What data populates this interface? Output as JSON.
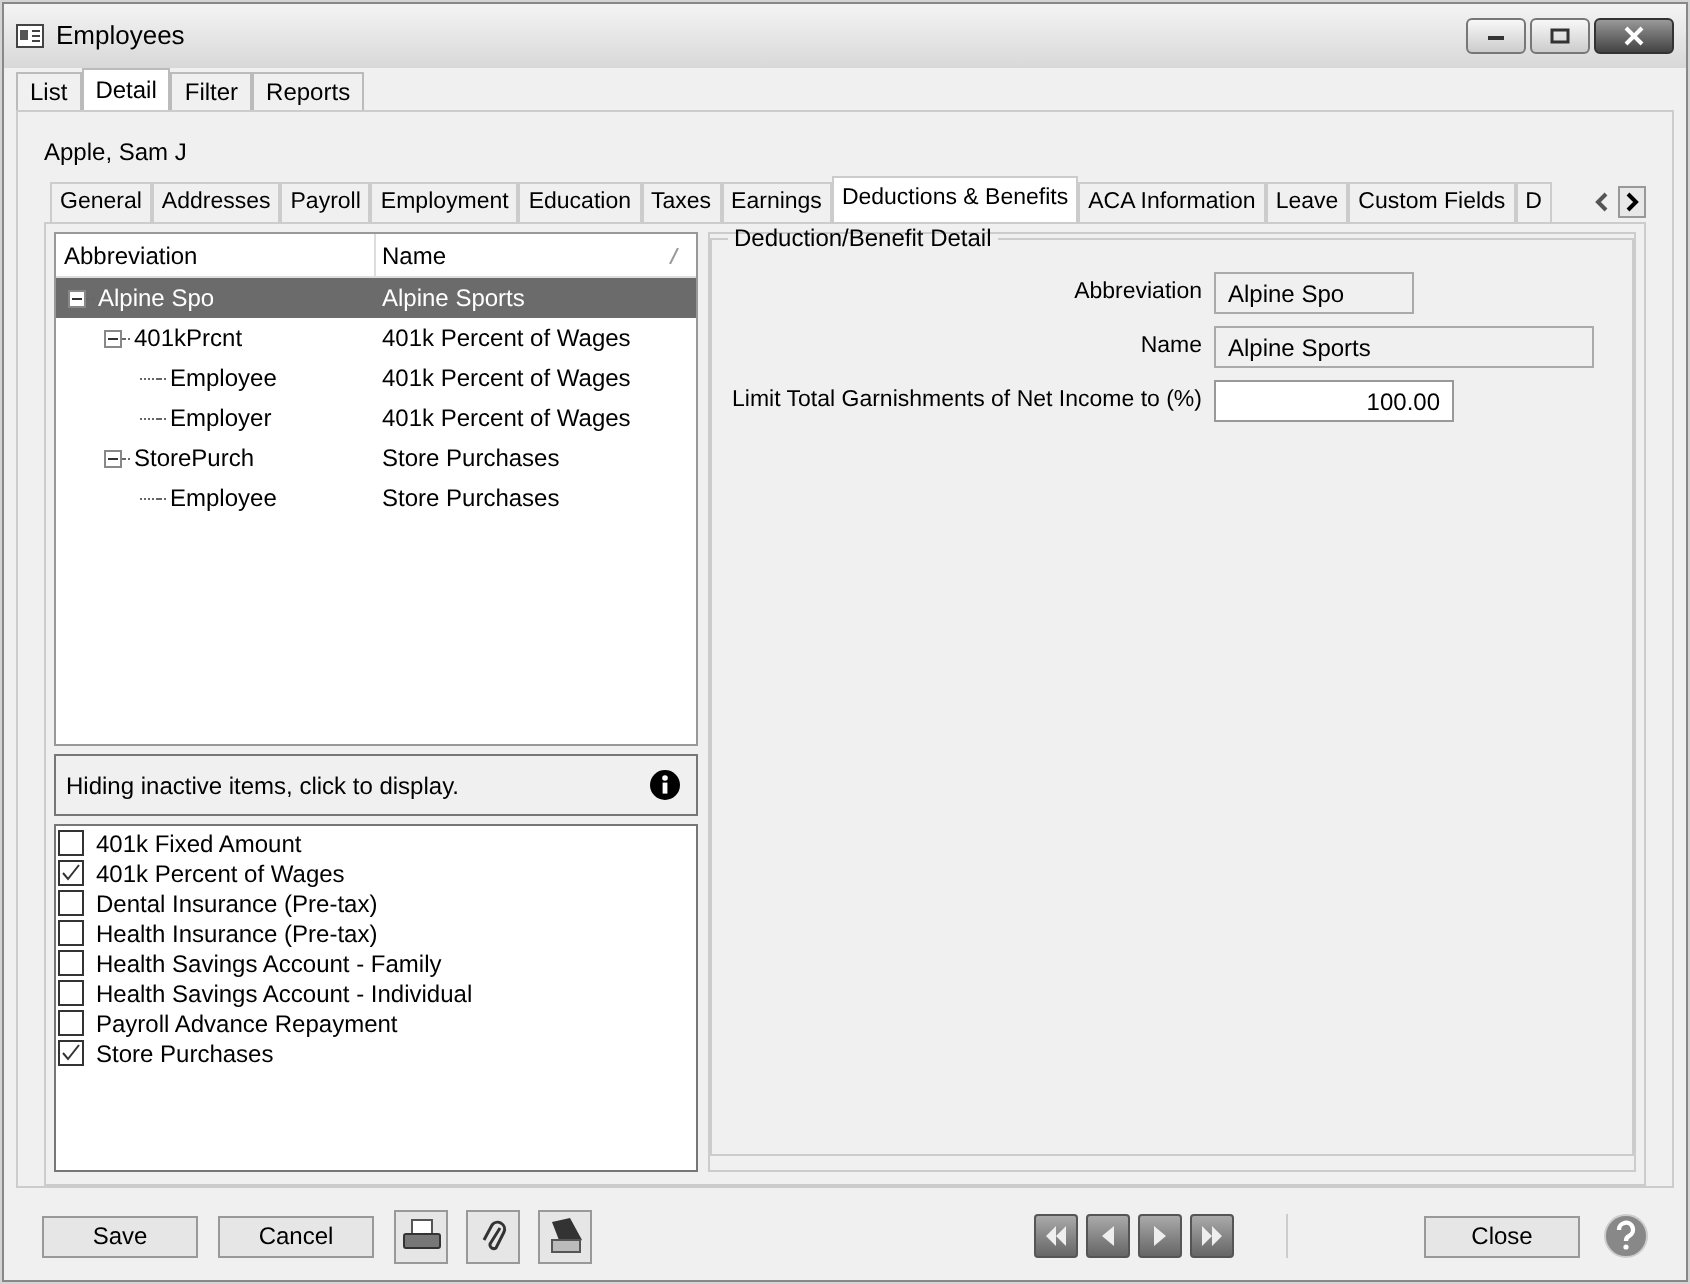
{
  "window": {
    "title": "Employees"
  },
  "top_tabs": [
    {
      "label": "List",
      "selected": false
    },
    {
      "label": "Detail",
      "selected": true
    },
    {
      "label": "Filter",
      "selected": false
    },
    {
      "label": "Reports",
      "selected": false
    }
  ],
  "employee_name": "Apple, Sam J",
  "detail_tabs": [
    {
      "label": "General",
      "selected": false
    },
    {
      "label": "Addresses",
      "selected": false
    },
    {
      "label": "Payroll",
      "selected": false
    },
    {
      "label": "Employment",
      "selected": false
    },
    {
      "label": "Education",
      "selected": false
    },
    {
      "label": "Taxes",
      "selected": false
    },
    {
      "label": "Earnings",
      "selected": false
    },
    {
      "label": "Deductions & Benefits",
      "selected": true
    },
    {
      "label": "ACA Information",
      "selected": false
    },
    {
      "label": "Leave",
      "selected": false
    },
    {
      "label": "Custom Fields",
      "selected": false
    },
    {
      "label": "D",
      "selected": false
    }
  ],
  "tree": {
    "columns": [
      "Abbreviation",
      "Name"
    ],
    "items": [
      {
        "abbreviation": "Alpine Spo",
        "name": "Alpine Sports",
        "expanded": true,
        "selected": true,
        "children": [
          {
            "abbreviation": "401kPrcnt",
            "name": "401k Percent of Wages",
            "expanded": true,
            "selected": false,
            "children": [
              {
                "abbreviation": "Employee",
                "name": "401k Percent of Wages",
                "selected": false
              },
              {
                "abbreviation": "Employer",
                "name": "401k Percent of Wages",
                "selected": false
              }
            ]
          },
          {
            "abbreviation": "StorePurch",
            "name": "Store Purchases",
            "expanded": true,
            "selected": false,
            "children": [
              {
                "abbreviation": "Employee",
                "name": "Store Purchases",
                "selected": false
              }
            ]
          }
        ]
      }
    ]
  },
  "info_bar": {
    "text": "Hiding inactive items, click to display."
  },
  "checklist": [
    {
      "label": "401k Fixed Amount",
      "checked": false
    },
    {
      "label": "401k Percent of Wages",
      "checked": true
    },
    {
      "label": "Dental Insurance (Pre-tax)",
      "checked": false
    },
    {
      "label": "Health Insurance (Pre-tax)",
      "checked": false
    },
    {
      "label": "Health Savings Account - Family",
      "checked": false
    },
    {
      "label": "Health Savings Account - Individual",
      "checked": false
    },
    {
      "label": "Payroll Advance Repayment",
      "checked": false
    },
    {
      "label": "Store Purchases",
      "checked": true
    }
  ],
  "detail": {
    "title": "Deduction/Benefit Detail",
    "fields": [
      {
        "label": "Abbreviation",
        "value": "Alpine Spo",
        "kind": "readonly"
      },
      {
        "label": "Name",
        "value": "Alpine Sports",
        "kind": "readonly"
      },
      {
        "label": "Limit Total Garnishments of Net Income to (%)",
        "value": "100.00",
        "kind": "number"
      }
    ]
  },
  "buttons": {
    "save": "Save",
    "cancel": "Cancel",
    "close": "Close"
  }
}
